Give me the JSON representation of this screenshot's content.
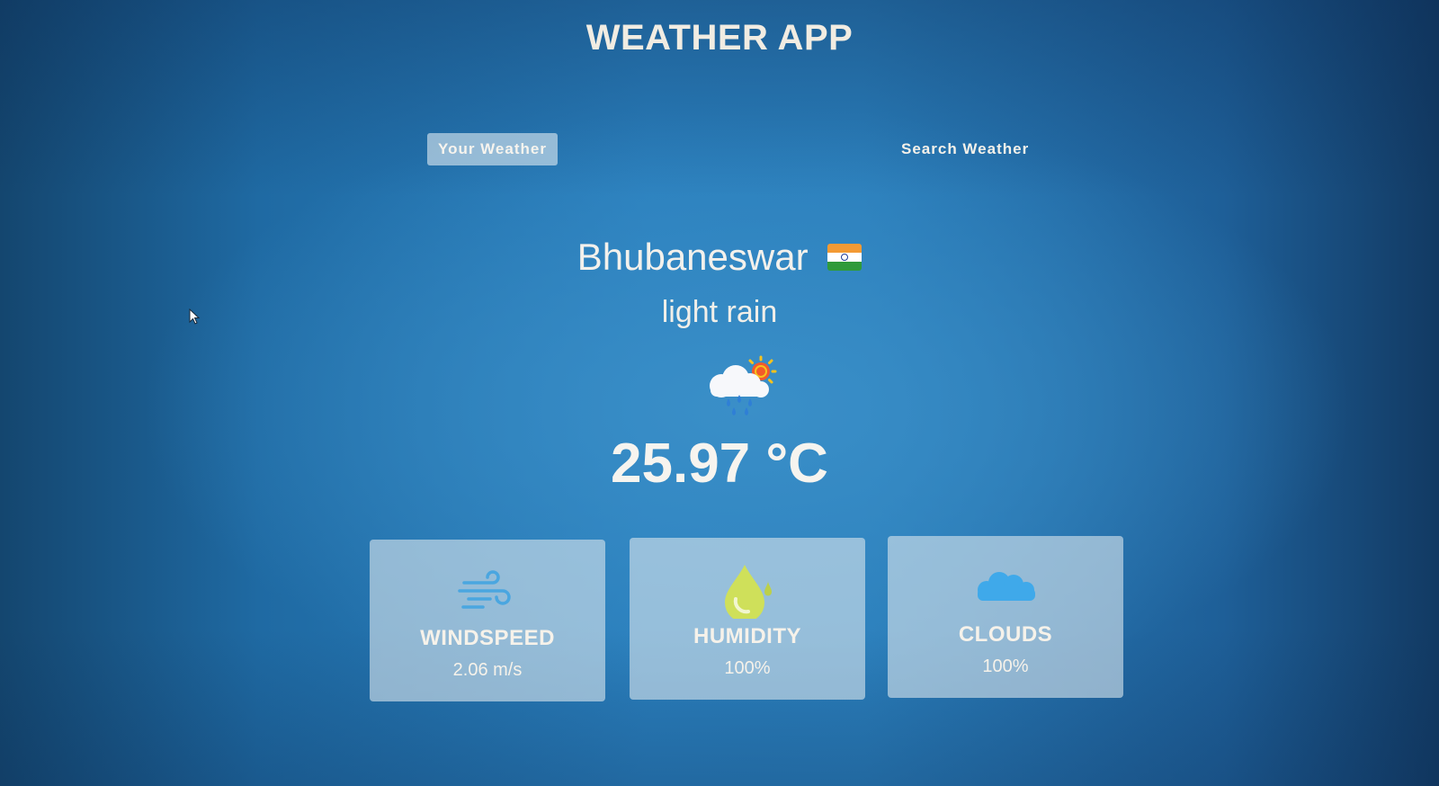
{
  "app": {
    "title": "WEATHER APP"
  },
  "tabs": [
    {
      "label": "Your Weather",
      "active": true
    },
    {
      "label": "Search Weather",
      "active": false
    }
  ],
  "current": {
    "city": "Bhubaneswar",
    "country_flag": "india-flag-icon",
    "description": "light rain",
    "condition_icon": "rain-cloud-sun-icon",
    "temperature": "25.97 °C"
  },
  "metrics": [
    {
      "icon": "wind-icon",
      "label": "WINDSPEED",
      "value": "2.06 m/s"
    },
    {
      "icon": "humidity-drop-icon",
      "label": "HUMIDITY",
      "value": "100%"
    },
    {
      "icon": "cloud-icon",
      "label": "CLOUDS",
      "value": "100%"
    }
  ],
  "colors": {
    "background": "#2a7ebb",
    "card": "#d7e4ec",
    "active_tab": "#dce8f0",
    "wind_icon": "#4aa6e0",
    "humidity_icon": "#cfe05a",
    "cloud_icon": "#3fa9ea"
  }
}
